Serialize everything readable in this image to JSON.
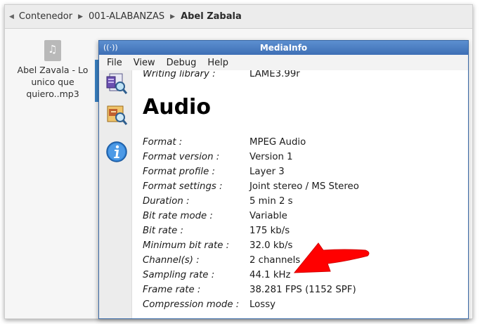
{
  "file_manager": {
    "breadcrumb": [
      "Contenedor",
      "001-ALABANZAS",
      "Abel Zabala"
    ],
    "file_name": "Abel Zavala - Lo unico que quiero..mp3"
  },
  "mediainfo": {
    "title": "MediaInfo",
    "menu": [
      "File",
      "View",
      "Debug",
      "Help"
    ],
    "toolbar_icons": [
      "sheet-view-icon",
      "tree-view-icon",
      "info-icon"
    ],
    "top_row": {
      "key": "Writing library :",
      "value": "LAME3.99r"
    },
    "section_title": "Audio",
    "rows": [
      {
        "key": "Format :",
        "value": "MPEG Audio"
      },
      {
        "key": "Format version :",
        "value": "Version 1"
      },
      {
        "key": "Format profile :",
        "value": "Layer 3"
      },
      {
        "key": "Format settings :",
        "value": "Joint stereo / MS Stereo"
      },
      {
        "key": "Duration :",
        "value": "5 min 2 s"
      },
      {
        "key": "Bit rate mode :",
        "value": "Variable"
      },
      {
        "key": "Bit rate :",
        "value": "175 kb/s"
      },
      {
        "key": "Minimum bit rate :",
        "value": "32.0 kb/s"
      },
      {
        "key": "Channel(s) :",
        "value": "2 channels"
      },
      {
        "key": "Sampling rate :",
        "value": "44.1 kHz"
      },
      {
        "key": "Frame rate :",
        "value": "38.281 FPS (1152 SPF)"
      },
      {
        "key": "Compression mode :",
        "value": "Lossy"
      }
    ]
  },
  "annotation": {
    "arrow_color": "#ff0000"
  }
}
